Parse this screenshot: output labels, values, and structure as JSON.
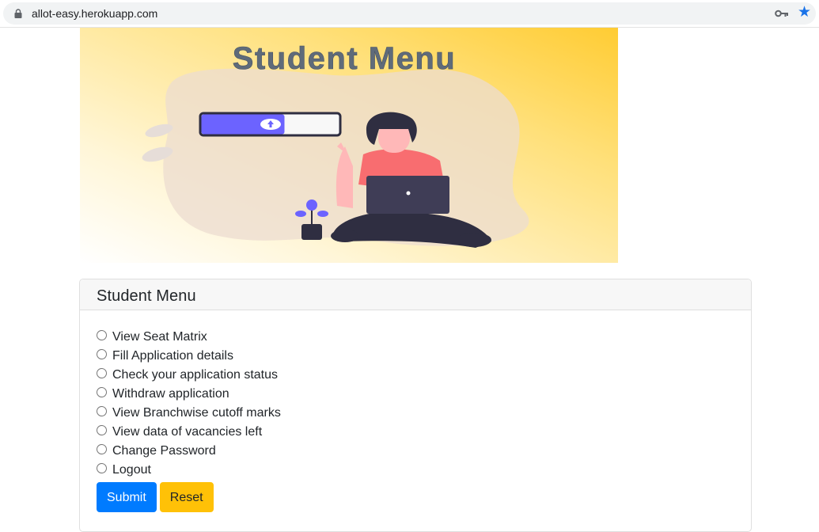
{
  "browser": {
    "url": "allot-easy.herokuapp.com",
    "icons": [
      "lock-icon",
      "key-icon",
      "star-icon"
    ],
    "accent": "#1a73e8"
  },
  "hero": {
    "heading": "Student Menu",
    "gradient_colors": [
      "#ffffff",
      "#ffd23f"
    ]
  },
  "card": {
    "title": "Student Menu",
    "options": [
      "View Seat Matrix",
      "Fill Application details",
      "Check your application status",
      "Withdraw application",
      "View Branchwise cutoff marks",
      "View data of vacancies left",
      "Change Password",
      "Logout"
    ],
    "submit_label": "Submit",
    "reset_label": "Reset"
  },
  "colors": {
    "primary": "#007bff",
    "warning": "#ffc107"
  }
}
